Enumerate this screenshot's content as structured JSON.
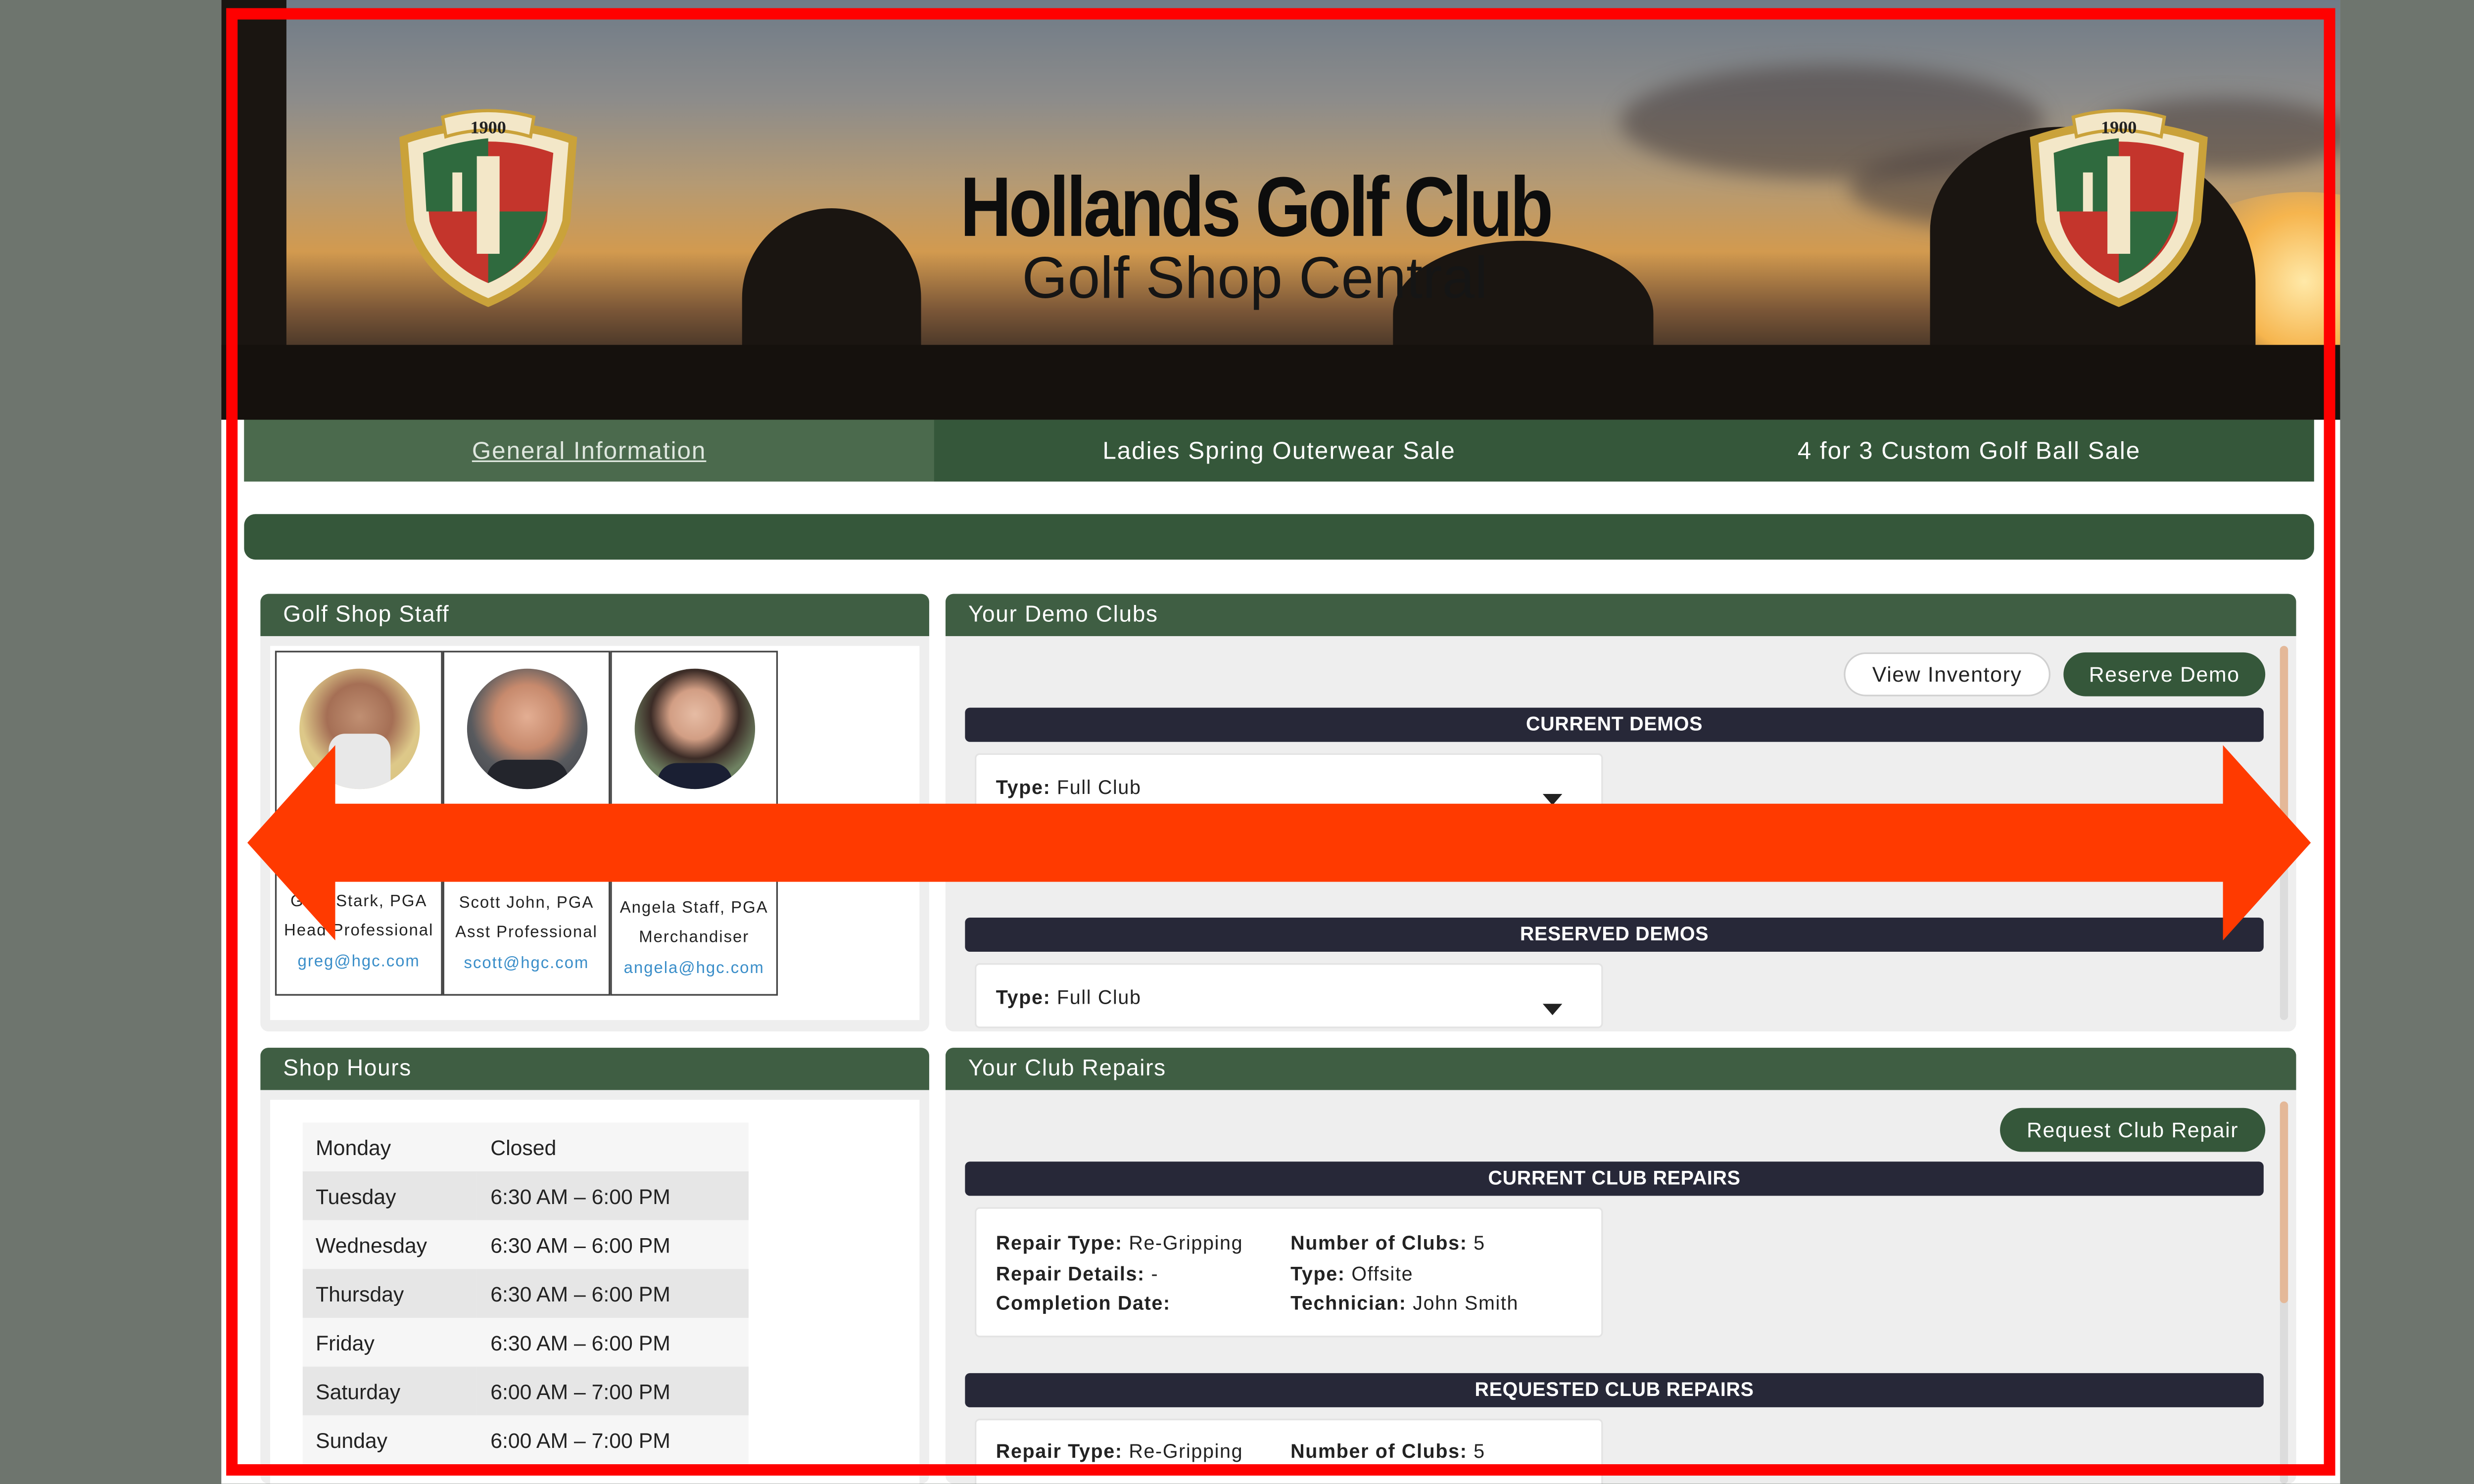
{
  "header": {
    "title": "Hollands Golf Club",
    "subtitle": "Golf Shop Central",
    "crest_year": "1900"
  },
  "nav": {
    "tabs": [
      {
        "label": "General Information",
        "active": true
      },
      {
        "label": "Ladies Spring Outerwear Sale",
        "active": false
      },
      {
        "label": "4 for 3 Custom Golf Ball Sale",
        "active": false
      }
    ]
  },
  "staff_panel": {
    "title": "Golf Shop Staff",
    "members": [
      {
        "name": "Greg Stark, PGA",
        "role": "Head Professional",
        "email": "greg@hgc.com"
      },
      {
        "name": "Scott John, PGA",
        "role": "Asst Professional",
        "email": "scott@hgc.com"
      },
      {
        "name": "Angela Staff, PGA",
        "role": "Merchandiser",
        "email": "angela@hgc.com"
      }
    ]
  },
  "demo_panel": {
    "title": "Your Demo Clubs",
    "view_inventory": "View Inventory",
    "reserve_demo": "Reserve Demo",
    "current_header": "CURRENT DEMOS",
    "reserved_header": "RESERVED DEMOS",
    "type_label": "Type:",
    "current_type": "Full Club",
    "reserved_type": "Full Club"
  },
  "hours_panel": {
    "title": "Shop Hours",
    "rows": [
      {
        "day": "Monday",
        "hours": "Closed"
      },
      {
        "day": "Tuesday",
        "hours": "6:30 AM – 6:00 PM"
      },
      {
        "day": "Wednesday",
        "hours": "6:30 AM – 6:00 PM"
      },
      {
        "day": "Thursday",
        "hours": "6:30 AM – 6:00 PM"
      },
      {
        "day": "Friday",
        "hours": "6:30 AM – 6:00 PM"
      },
      {
        "day": "Saturday",
        "hours": "6:00 AM – 7:00 PM"
      },
      {
        "day": "Sunday",
        "hours": "6:00 AM – 7:00 PM"
      }
    ]
  },
  "repairs_panel": {
    "title": "Your Club Repairs",
    "request_button": "Request Club Repair",
    "current_header": "CURRENT CLUB REPAIRS",
    "requested_header": "REQUESTED CLUB REPAIRS",
    "labels": {
      "repair_type": "Repair Type:",
      "repair_details": "Repair Details:",
      "completion_date": "Completion Date:",
      "number_of_clubs": "Number of Clubs:",
      "type": "Type:",
      "technician": "Technician:"
    },
    "current": {
      "repair_type": "Re-Gripping",
      "repair_details": "-",
      "completion_date": "",
      "number_of_clubs": "5",
      "type": "Offsite",
      "technician": "John Smith"
    },
    "requested": {
      "repair_type": "Re-Gripping",
      "number_of_clubs": "5"
    }
  },
  "colors": {
    "nav_green": "#35573a",
    "panel_header_green": "#3f5e43",
    "section_bar": "#272838",
    "annotation_red": "#ff0000",
    "arrow_orange": "#ff3a00",
    "email_link": "#3a8ec9"
  }
}
